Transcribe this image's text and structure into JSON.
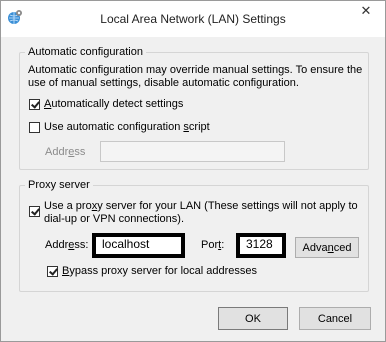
{
  "window": {
    "title": "Local Area Network (LAN) Settings",
    "close_glyph": "✕"
  },
  "auto_config": {
    "legend": "Automatic configuration",
    "description": "Automatic configuration may override manual settings.  To ensure the use of manual settings, disable automatic configuration.",
    "detect_label_pre": "",
    "detect_label_accel": "A",
    "detect_label_post": "utomatically detect settings",
    "detect_checked": true,
    "script_label_pre": "Use automatic configuration ",
    "script_label_accel": "s",
    "script_label_post": "cript",
    "script_checked": false,
    "address_label_pre": "Addr",
    "address_label_accel": "e",
    "address_label_post": "ss",
    "address_value": ""
  },
  "proxy": {
    "legend": "Proxy server",
    "use_label_pre": "Use a pro",
    "use_label_accel": "x",
    "use_label_post": "y server for your LAN (These settings will not apply to dial-up or VPN connections).",
    "use_checked": true,
    "address_label_pre": "Addr",
    "address_label_accel": "e",
    "address_label_post": "ss:",
    "address_value": "localhost",
    "port_label_pre": "Por",
    "port_label_accel": "t",
    "port_label_post": ":",
    "port_value": "3128",
    "advanced_pre": "Adva",
    "advanced_accel": "n",
    "advanced_post": "ced",
    "bypass_label_pre": "",
    "bypass_label_accel": "B",
    "bypass_label_post": "ypass proxy server for local addresses",
    "bypass_checked": true
  },
  "buttons": {
    "ok": "OK",
    "cancel": "Cancel"
  },
  "icons": {
    "app": "internet-options-icon",
    "close": "close-icon"
  }
}
